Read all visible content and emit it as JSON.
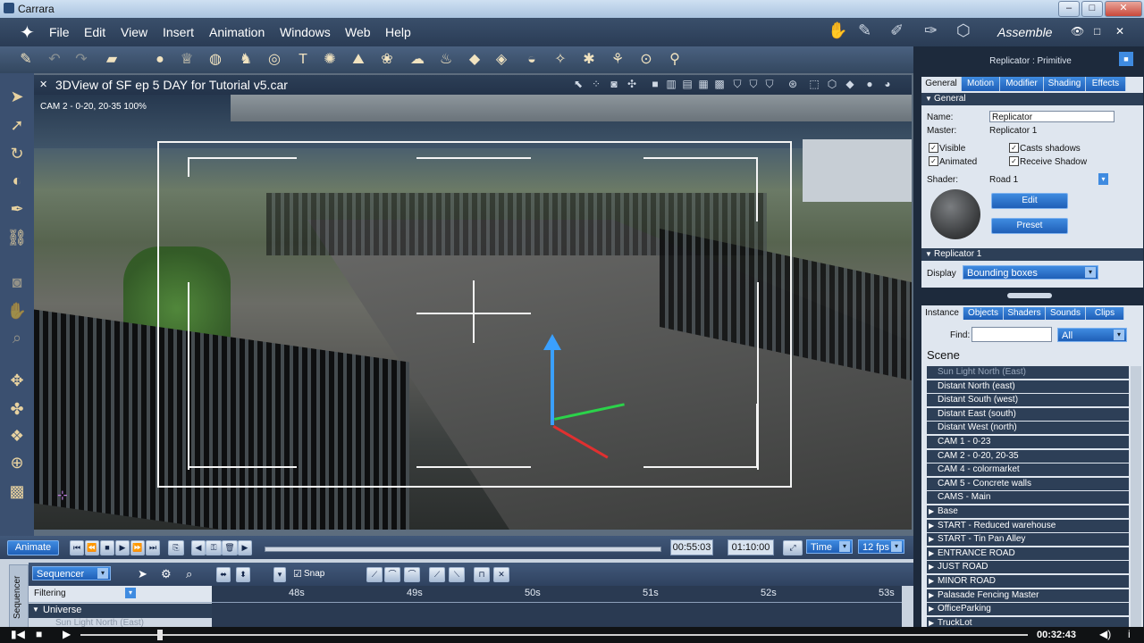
{
  "window": {
    "title": "Carrara",
    "controls": [
      "–",
      "□",
      "✕"
    ]
  },
  "menu": [
    "File",
    "Edit",
    "View",
    "Insert",
    "Animation",
    "Windows",
    "Web",
    "Help"
  ],
  "room": {
    "name": "Assemble",
    "controls": [
      "👁",
      "□",
      "✕"
    ]
  },
  "viewport": {
    "title": "3DView of SF ep 5 DAY for Tutorial v5.car",
    "camera_label": "CAM 2 - 0-20, 20-35 100%"
  },
  "transport": {
    "animate_label": "Animate",
    "current_time": "00:55:03",
    "end_time": "01:10:00",
    "time_mode": "Time",
    "fps": "12 fps"
  },
  "sequencer": {
    "tab_label": "Sequencer",
    "mode": "Sequencer",
    "filter_label": "Filtering",
    "snap_label": "Snap",
    "universe_label": "Universe",
    "first_item": "Sun Light North (East)",
    "ticks": [
      "48s",
      "49s",
      "50s",
      "51s",
      "52s",
      "53s"
    ]
  },
  "player": {
    "time": "00:32:43"
  },
  "properties": {
    "header": "Replicator : Primitive",
    "tabs": [
      "General",
      "Motion",
      "Modifier",
      "Shading",
      "Effects"
    ],
    "general_section": "General",
    "name_label": "Name:",
    "name_value": "Replicator",
    "master_label": "Master:",
    "master_value": "Replicator 1",
    "visible_label": "Visible",
    "animated_label": "Animated",
    "casts_shadows_label": "Casts shadows",
    "receive_shadow_label": "Receive Shadow",
    "shader_label": "Shader:",
    "shader_value": "Road 1",
    "edit_label": "Edit",
    "preset_label": "Preset",
    "replicator_section": "Replicator 1",
    "display_label": "Display",
    "display_value": "Bounding boxes"
  },
  "scene": {
    "tabs": [
      "Instance",
      "Objects",
      "Shaders",
      "Sounds",
      "Clips"
    ],
    "find_label": "Find:",
    "find_value": "",
    "filter_value": "All",
    "title": "Scene",
    "items": [
      {
        "label": "Sun Light North (East)",
        "group": false,
        "dim": true
      },
      {
        "label": "Distant North (east)",
        "group": false,
        "dim": false
      },
      {
        "label": "Distant South (west)",
        "group": false,
        "dim": false
      },
      {
        "label": "Distant East (south)",
        "group": false,
        "dim": false
      },
      {
        "label": "Distant West (north)",
        "group": false,
        "dim": false
      },
      {
        "label": "CAM 1 - 0-23",
        "group": false,
        "dim": false
      },
      {
        "label": "CAM 2 - 0-20, 20-35",
        "group": false,
        "dim": false
      },
      {
        "label": "CAM 4 - colormarket",
        "group": false,
        "dim": false
      },
      {
        "label": "CAM 5 - Concrete walls",
        "group": false,
        "dim": false
      },
      {
        "label": "CAMS - Main",
        "group": false,
        "dim": false
      },
      {
        "label": "Base",
        "group": true,
        "dim": false
      },
      {
        "label": "START - Reduced warehouse",
        "group": true,
        "dim": false
      },
      {
        "label": "START - Tin Pan Alley",
        "group": true,
        "dim": false
      },
      {
        "label": "ENTRANCE ROAD",
        "group": true,
        "dim": false
      },
      {
        "label": "JUST ROAD",
        "group": true,
        "dim": false
      },
      {
        "label": "MINOR ROAD",
        "group": true,
        "dim": false
      },
      {
        "label": "Palasade Fencing Master",
        "group": true,
        "dim": false
      },
      {
        "label": "OfficeParking",
        "group": true,
        "dim": false
      },
      {
        "label": "TruckLot",
        "group": true,
        "dim": false
      }
    ]
  }
}
